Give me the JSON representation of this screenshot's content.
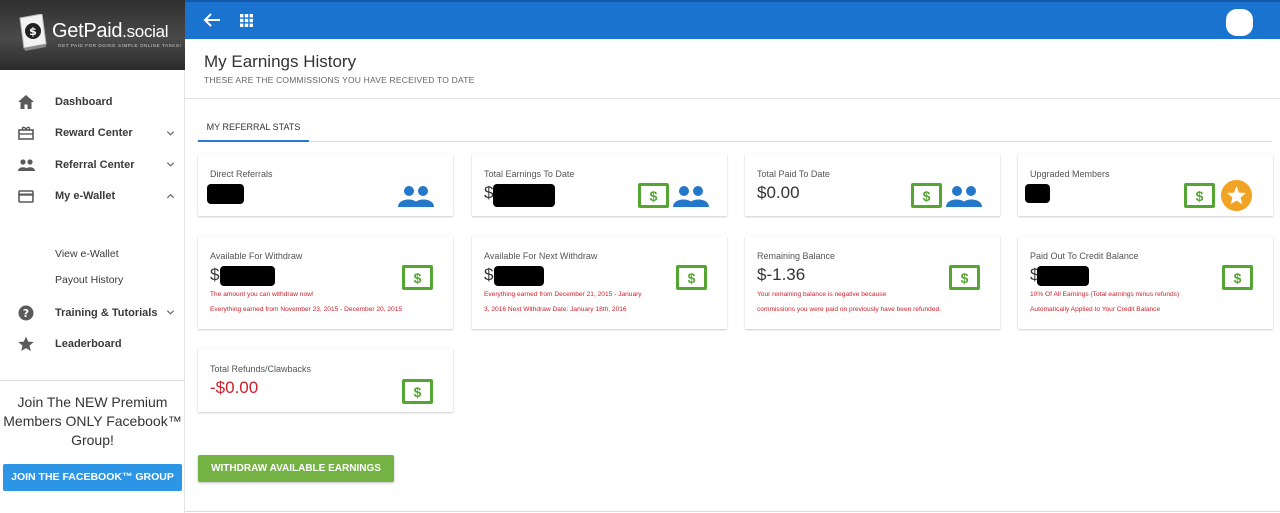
{
  "brand": {
    "name": "GetPaid",
    "domain": ".social",
    "tagline": "GET PAID FOR DOING SIMPLE ONLINE TASKS!"
  },
  "sidebar": {
    "items": [
      {
        "label": "Dashboard",
        "icon": "home-icon"
      },
      {
        "label": "Reward Center",
        "icon": "gift-icon",
        "expanded": false
      },
      {
        "label": "Referral Center",
        "icon": "people-icon",
        "expanded": false
      },
      {
        "label": "My e-Wallet",
        "icon": "wallet-icon",
        "expanded": true
      }
    ],
    "subitems": [
      {
        "label": "View e-Wallet"
      },
      {
        "label": "Payout History"
      }
    ],
    "items2": [
      {
        "label": "Training & Tutorials",
        "icon": "help-icon",
        "expanded": false
      },
      {
        "label": "Leaderboard",
        "icon": "star-icon"
      }
    ],
    "promo_text": "Join The NEW Premium Members ONLY Facebook™ Group!",
    "promo_button": "JOIN THE FACEBOOK™ GROUP"
  },
  "header": {
    "title": "My Earnings History",
    "subtitle": "THESE ARE THE COMMISSIONS YOU HAVE RECEIVED TO DATE"
  },
  "tabs": [
    {
      "label": "MY REFERRAL STATS",
      "active": true
    }
  ],
  "cards": {
    "direct_referrals": {
      "label": "Direct Referrals",
      "value": ""
    },
    "total_earnings": {
      "label": "Total Earnings To Date",
      "value": "$"
    },
    "total_paid": {
      "label": "Total Paid To Date",
      "value": "$0.00"
    },
    "upgraded_members": {
      "label": "Upgraded Members",
      "value": ""
    },
    "available_withdraw": {
      "label": "Available For Withdraw",
      "value": "$",
      "note1": "The amount you can withdraw now!",
      "note2": "Everything earned from November 23, 2015 - December 20, 2015"
    },
    "next_withdraw": {
      "label": "Available For Next Withdraw",
      "value": "$",
      "note1": "Everything earned from December 21, 2015 - January",
      "note2": "3, 2016 Next Withdraw Date: January 18th, 2016"
    },
    "remaining_balance": {
      "label": "Remaining Balance",
      "value": "$-1.36",
      "note1": "Your remaining balance is negative because",
      "note2": "commissions you were paid on previously have been refunded."
    },
    "credit_balance": {
      "label": "Paid Out To Credit Balance",
      "value": "$",
      "note1": "10% Of All Earnings (Total earnings minus refunds)",
      "note2": "Automatically Applied to Your Credit Balance"
    },
    "refunds": {
      "label": "Total Refunds/Clawbacks",
      "value": "-$0.00"
    }
  },
  "dollar_glyph": "$",
  "withdraw_button": "WITHDRAW AVAILABLE EARNINGS",
  "colors": {
    "topbar": "#1b73d0",
    "accent_blue": "#2c95e6",
    "green": "#55a533",
    "negative": "#d0202a",
    "gold": "#f1a325"
  }
}
